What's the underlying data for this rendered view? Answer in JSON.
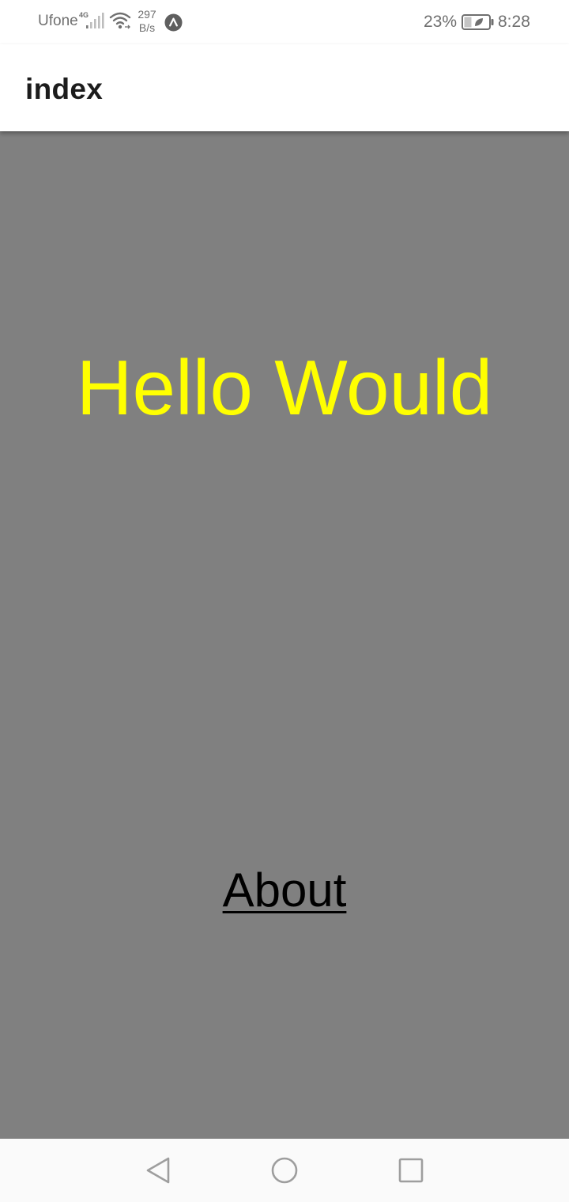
{
  "status_bar": {
    "carrier": "Ufone",
    "network_type": "4G",
    "net_speed_value": "297",
    "net_speed_unit": "B/s",
    "battery_percent": "23%",
    "time": "8:28",
    "icons": [
      "signal-icon",
      "wifi-icon",
      "app-notification-icon",
      "battery-icon"
    ]
  },
  "header": {
    "title": "index"
  },
  "main": {
    "hello_text": "Hello Would",
    "about_link": "About"
  },
  "nav_bar": {
    "icons": [
      "back-icon",
      "home-icon",
      "recents-icon"
    ]
  },
  "colors": {
    "content_background": "#808080",
    "hello_text": "#ffff00",
    "link_text": "#000000",
    "header_background": "#ffffff",
    "nav_background": "#fafafa"
  }
}
